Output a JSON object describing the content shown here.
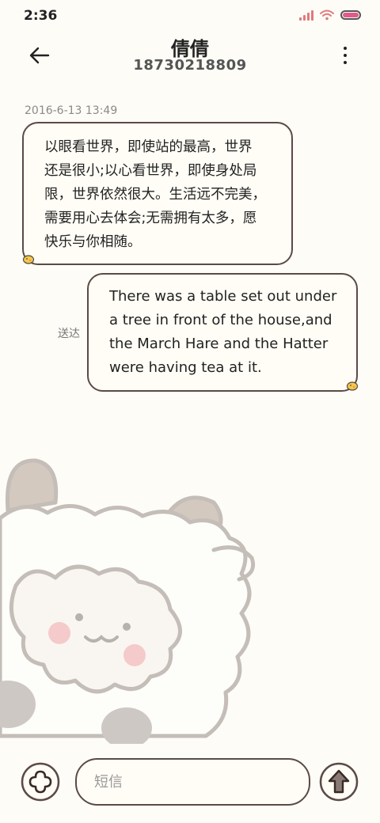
{
  "status_bar": {
    "time": "2:36",
    "signal_icon": "signal-icon",
    "wifi_icon": "wifi-icon",
    "battery_icon": "battery-icon",
    "accent_color": "#e07a7a"
  },
  "header": {
    "back_icon": "arrow-left-icon",
    "contact_name": "倩倩",
    "contact_number": "18730218809",
    "more_icon": "more-vertical-icon"
  },
  "conversation": {
    "timestamp": "2016-6-13 13:49",
    "messages": [
      {
        "direction": "incoming",
        "lines": [
          "以眼看世界，即使站的最高，世界",
          "还是很小;以心看世界，即使身处局",
          "限，世界依然很大。生活远不完美，",
          "需要用心去体会;无需拥有太多，愿",
          "快乐与你相随。"
        ],
        "sticker_icon": "duck-sticker-icon"
      },
      {
        "direction": "outgoing",
        "lines": [
          "There was a table set out under",
          "a tree in front of the house,and",
          "the March Hare and the Hatter",
          "were having tea at it."
        ],
        "status": "送达",
        "sticker_icon": "duck-sticker-icon"
      }
    ]
  },
  "composer": {
    "add_icon": "plus-circle-icon",
    "placeholder": "短信",
    "value": "",
    "send_icon": "send-arrow-up-icon"
  },
  "colors": {
    "background": "#fdfcf7",
    "bubble_border": "#5b4a46",
    "timestamp": "#8a8a8a"
  }
}
